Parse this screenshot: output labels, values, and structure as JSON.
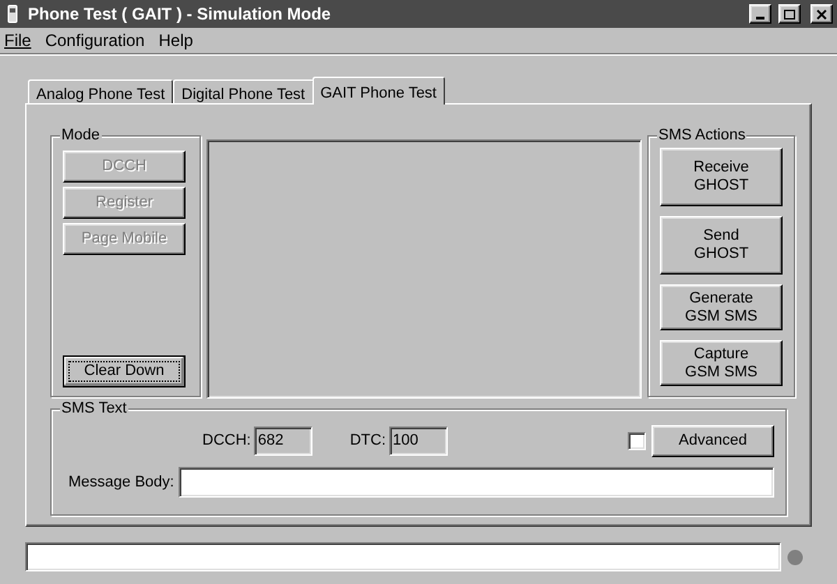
{
  "window": {
    "title": "Phone Test ( GAIT ) - Simulation Mode"
  },
  "menu": [
    {
      "label": "File",
      "mnemonic_underlined": true
    },
    {
      "label": "Configuration",
      "mnemonic_underlined": false
    },
    {
      "label": "Help",
      "mnemonic_underlined": false
    }
  ],
  "tabs": [
    {
      "label": "Analog Phone Test",
      "selected": false
    },
    {
      "label": "Digital Phone Test",
      "selected": false
    },
    {
      "label": "GAIT Phone Test",
      "selected": true
    }
  ],
  "mode": {
    "title": "Mode",
    "buttons": [
      {
        "label": "DCCH",
        "disabled": true
      },
      {
        "label": "Register",
        "disabled": true
      },
      {
        "label": "Page Mobile",
        "disabled": true
      }
    ],
    "clear_button": {
      "label": "Clear Down",
      "focused": true
    }
  },
  "sms_actions": {
    "title": "SMS Actions",
    "buttons": [
      {
        "lines": [
          "Receive",
          "GHOST"
        ],
        "disabled": false
      },
      {
        "lines": [
          "Send",
          "GHOST"
        ],
        "disabled": false
      },
      {
        "lines": [
          "Generate",
          "GSM SMS"
        ],
        "disabled": false
      },
      {
        "lines": [
          "Capture",
          "GSM SMS"
        ],
        "disabled": false
      }
    ]
  },
  "sms_text": {
    "title": "SMS Text",
    "dcch_label": "DCCH:",
    "dcch_value": "682",
    "dtc_label": "DTC:",
    "dtc_value": "100",
    "advanced_checked": false,
    "advanced_label": "Advanced",
    "message_label": "Message Body:"
  }
}
